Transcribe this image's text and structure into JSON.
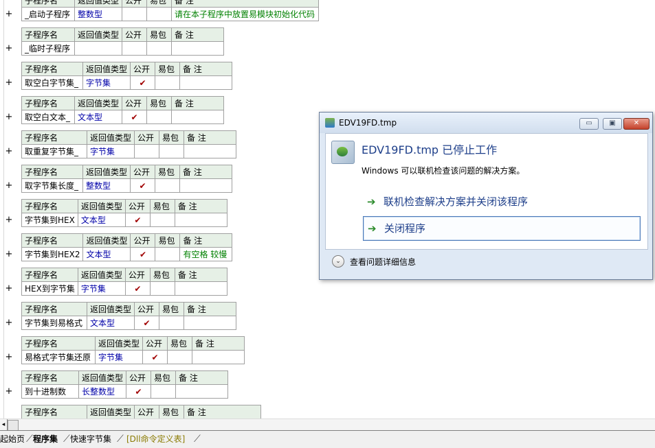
{
  "headers": {
    "name": "子程序名",
    "ret": "返回值类型",
    "pub": "公开",
    "pkg": "易包",
    "note": "备 注"
  },
  "plus": "+",
  "check": "✔",
  "subs": [
    {
      "name": "_启动子程序",
      "ret": "整数型",
      "pub": "",
      "note": "请在本子程序中放置易模块初始化代码"
    },
    {
      "name": "_临时子程序",
      "ret": "",
      "pub": "",
      "note": ""
    },
    {
      "name": "取空白字节集_",
      "ret": "字节集",
      "pub": "check",
      "note": ""
    },
    {
      "name": "取空白文本_",
      "ret": "文本型",
      "pub": "check",
      "note": ""
    },
    {
      "name": "取重复字节集_",
      "ret": "字节集",
      "pub": "",
      "note": ""
    },
    {
      "name": "取字节集长度_",
      "ret": "整数型",
      "pub": "check",
      "note": ""
    },
    {
      "name": "字节集到HEX",
      "ret": "文本型",
      "pub": "check",
      "note": ""
    },
    {
      "name": "字节集到HEX2",
      "ret": "文本型",
      "pub": "check",
      "note": "有空格 较慢"
    },
    {
      "name": "HEX到字节集",
      "ret": "字节集",
      "pub": "check",
      "note": ""
    },
    {
      "name": "字节集到易格式",
      "ret": "文本型",
      "pub": "check",
      "note": ""
    },
    {
      "name": "易格式字节集还原",
      "ret": "字节集",
      "pub": "check",
      "note": ""
    },
    {
      "name": "到十进制数",
      "ret": "长整数型",
      "pub": "check",
      "note": ""
    }
  ],
  "tabs": [
    "起始页",
    "程序集",
    "快速字节集",
    "[Dll命令定义表]"
  ],
  "dialog": {
    "title": "EDV19FD.tmp",
    "main": "EDV19FD.tmp 已停止工作",
    "sub": "Windows 可以联机检查该问题的解决方案。",
    "option1": "联机检查解决方案并关闭该程序",
    "option2": "关闭程序",
    "details": "查看问题详细信息",
    "minimize": "▭",
    "maximize": "▣",
    "close": "✕"
  },
  "icons": {
    "arrow": "➔",
    "chevron": "⌄",
    "scroll_left": "◂"
  }
}
